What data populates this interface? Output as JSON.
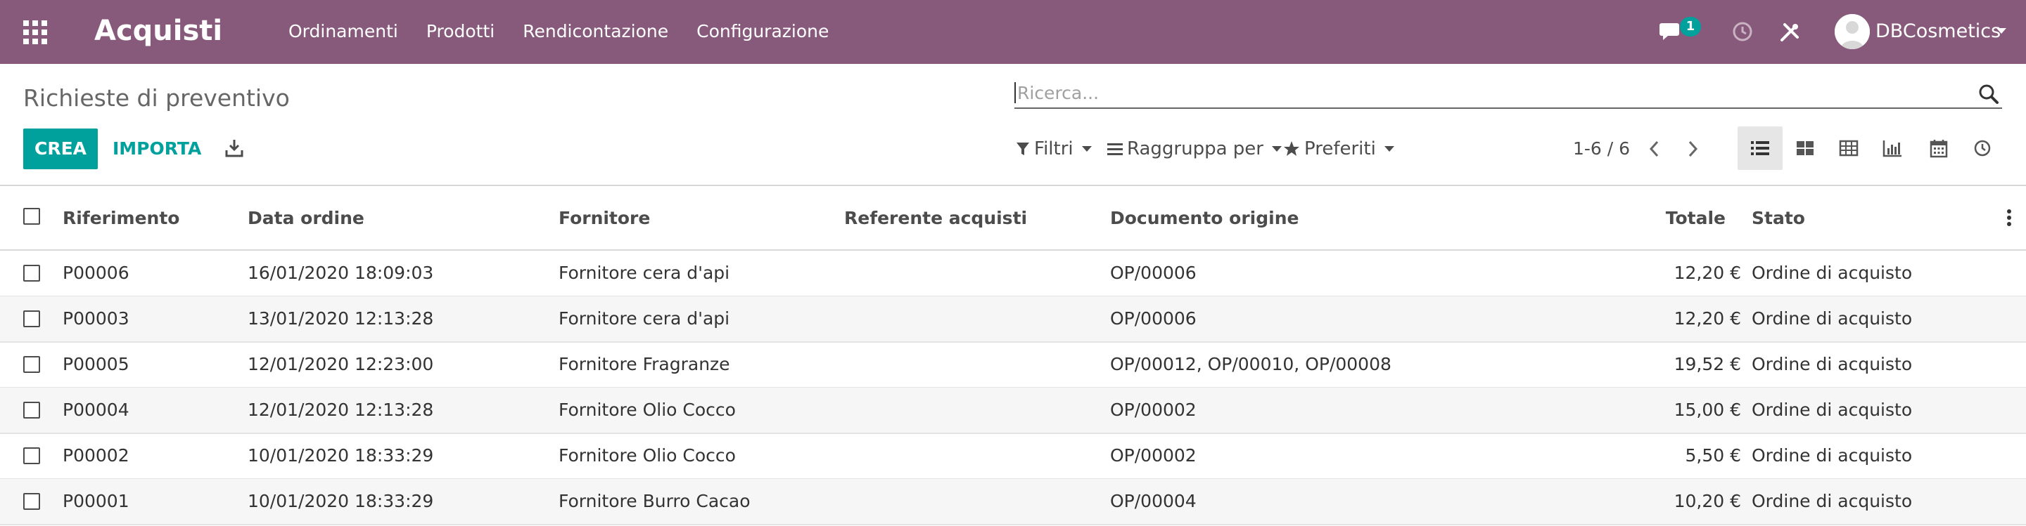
{
  "navbar": {
    "app_title": "Acquisti",
    "menu": [
      "Ordinamenti",
      "Prodotti",
      "Rendicontazione",
      "Configurazione"
    ],
    "chat_badge": "1",
    "user_name": "DBCosmetics",
    "color": "#875a7b"
  },
  "control_panel": {
    "breadcrumb": "Richieste di preventivo",
    "search_placeholder": "Ricerca...",
    "create_label": "CREA",
    "import_label": "IMPORTA",
    "filters_label": "Filtri",
    "groupby_label": "Raggruppa per",
    "favorites_label": "Preferiti",
    "pager": "1-6 / 6",
    "views": [
      "list",
      "kanban",
      "pivot",
      "graph",
      "calendar",
      "activity"
    ],
    "active_view": "list",
    "accent": "#00a09d"
  },
  "table": {
    "columns": [
      "Riferimento",
      "Data ordine",
      "Fornitore",
      "Referente acquisti",
      "Documento origine",
      "Totale",
      "Stato"
    ],
    "rows": [
      {
        "ref": "P00006",
        "date": "16/01/2020 18:09:03",
        "vendor": "Fornitore cera d'api",
        "buyer": "",
        "origin": "OP/00006",
        "total": "12,20 €",
        "status": "Ordine di acquisto"
      },
      {
        "ref": "P00003",
        "date": "13/01/2020 12:13:28",
        "vendor": "Fornitore cera d'api",
        "buyer": "",
        "origin": "OP/00006",
        "total": "12,20 €",
        "status": "Ordine di acquisto"
      },
      {
        "ref": "P00005",
        "date": "12/01/2020 12:23:00",
        "vendor": "Fornitore Fragranze",
        "buyer": "",
        "origin": "OP/00012, OP/00010, OP/00008",
        "total": "19,52 €",
        "status": "Ordine di acquisto"
      },
      {
        "ref": "P00004",
        "date": "12/01/2020 12:13:28",
        "vendor": "Fornitore Olio Cocco",
        "buyer": "",
        "origin": "OP/00002",
        "total": "15,00 €",
        "status": "Ordine di acquisto"
      },
      {
        "ref": "P00002",
        "date": "10/01/2020 18:33:29",
        "vendor": "Fornitore Olio Cocco",
        "buyer": "",
        "origin": "OP/00002",
        "total": "5,50 €",
        "status": "Ordine di acquisto"
      },
      {
        "ref": "P00001",
        "date": "10/01/2020 18:33:29",
        "vendor": "Fornitore Burro Cacao",
        "buyer": "",
        "origin": "OP/00004",
        "total": "10,20 €",
        "status": "Ordine di acquisto"
      }
    ]
  }
}
